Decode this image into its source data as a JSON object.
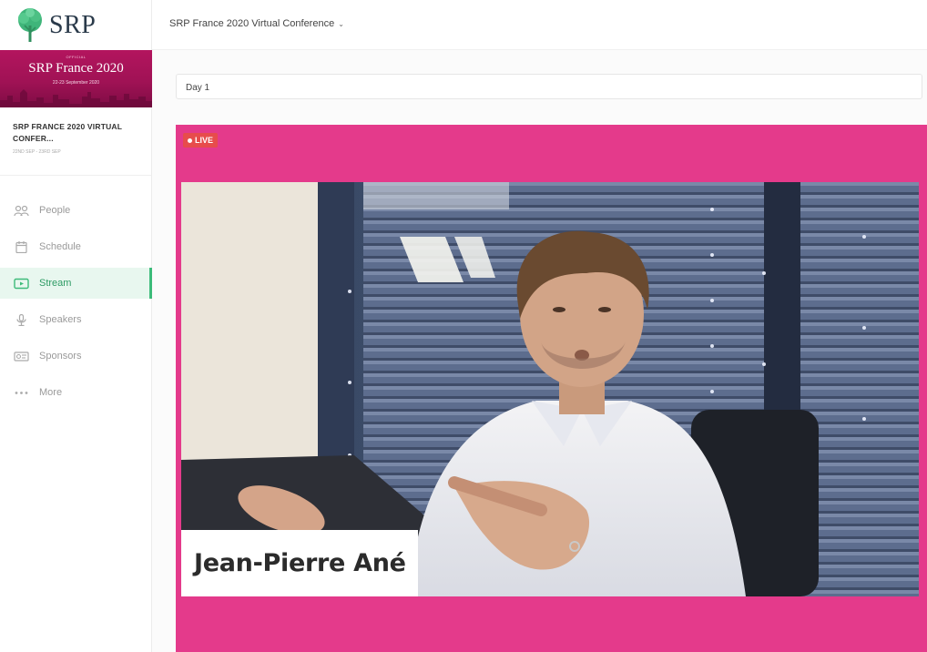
{
  "sidebar": {
    "logo_text": "SRP",
    "banner": {
      "official": "OFFICIAL",
      "title": "SRP France 2020",
      "dates": "22-23 September 2020"
    },
    "event_title": "SRP FRANCE 2020 VIRTUAL CONFER...",
    "event_time": "22ND SEP - 23RD SEP",
    "nav": [
      {
        "label": "People",
        "icon": "people-icon"
      },
      {
        "label": "Schedule",
        "icon": "calendar-icon"
      },
      {
        "label": "Stream",
        "icon": "stream-icon",
        "active": true
      },
      {
        "label": "Speakers",
        "icon": "microphone-icon"
      },
      {
        "label": "Sponsors",
        "icon": "sponsor-icon"
      },
      {
        "label": "More",
        "icon": "more-icon"
      }
    ]
  },
  "topbar": {
    "conference_selector": "SRP France 2020 Virtual Conference",
    "chevron": "⌄"
  },
  "main": {
    "day_select_value": "Day 1",
    "stream": {
      "live_label": "LIVE",
      "speaker_name": "Jean-Pierre Ané"
    }
  },
  "colors": {
    "brand_pink": "#e43a8b",
    "banner_magenta": "#a01255",
    "active_green": "#3dbb7a",
    "live_red": "#e74c4c"
  }
}
